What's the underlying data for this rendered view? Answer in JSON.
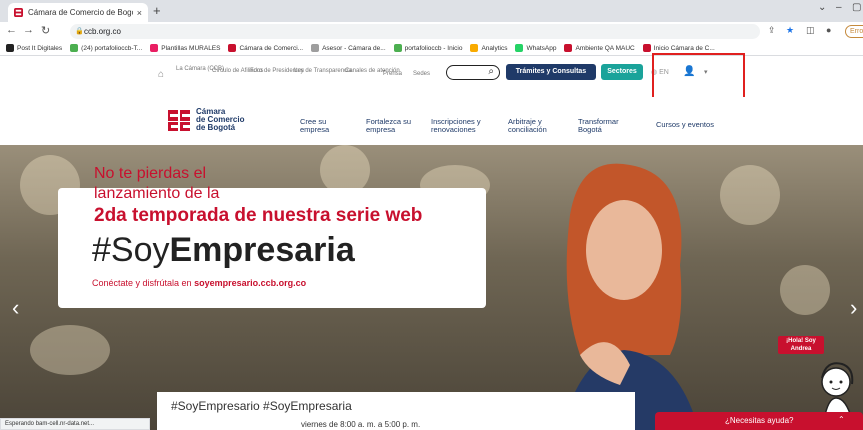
{
  "browser": {
    "tab_title": "Cámara de Comercio de Bogotá",
    "tab_close": "×",
    "new_tab": "+",
    "url": "ccb.org.co",
    "profile_label": "Erro",
    "status_text": "Esperando bam-cell.nr-data.net..."
  },
  "bookmarks": [
    {
      "label": "Post It Digitales",
      "color": "#222222"
    },
    {
      "label": "(24) portafolioccb-T...",
      "color": "#4caf50"
    },
    {
      "label": "Plantillas MURALES",
      "color": "#e91e63"
    },
    {
      "label": "Cámara de Comerci...",
      "color": "#c8102e"
    },
    {
      "label": "Asesor - Cámara de...",
      "color": "#9e9e9e"
    },
    {
      "label": "portafolioccb - Inicio",
      "color": "#4caf50"
    },
    {
      "label": "Analytics",
      "color": "#f9ab00"
    },
    {
      "label": "WhatsApp",
      "color": "#25d366"
    },
    {
      "label": "Ambiente QA MAUC",
      "color": "#c8102e"
    },
    {
      "label": "Inicio Cámara de C...",
      "color": "#c8102e"
    }
  ],
  "utility_nav": {
    "items": [
      {
        "label": "La Cámara (CCB)"
      },
      {
        "label": "Círculo de Afiliados"
      },
      {
        "label": "Foro de Presidentes"
      },
      {
        "label": "Ley de Transparencia"
      },
      {
        "label": "Canales de atención"
      },
      {
        "label": "Prensa"
      },
      {
        "label": "Sedes"
      }
    ],
    "tramites_label": "Trámites y Consultas",
    "sectores_label": "Sectores",
    "lang_label": "EN"
  },
  "main_nav": {
    "logo_text": [
      "Cámara",
      "de Comercio",
      "de Bogotá"
    ],
    "items": [
      {
        "label": "Cree su empresa"
      },
      {
        "label": "Fortalezca su empresa"
      },
      {
        "label": "Inscripciones y renovaciones"
      },
      {
        "label": "Arbitraje y conciliación"
      },
      {
        "label": "Transformar Bogotá"
      },
      {
        "label": "Cursos y eventos"
      }
    ]
  },
  "hero": {
    "top_line1": "No te pierdas el",
    "top_line2": "lanzamiento de la",
    "headline": "2da temporada de nuestra serie web",
    "hashtag_light": "#Soy",
    "hashtag_bold": "Empresaria",
    "sub_prefix": "Conéctate y disfrútala en ",
    "sub_link": "soyempresario.ccb.org.co",
    "badge": "¡Hola! Soy Andrea",
    "bottom_hashtag": "#SoyEmpresario #SoyEmpresaria",
    "bottom_hours": "viernes de 8:00 a. m. a 5:00 p. m.",
    "help": "¿Necesitas ayuda?"
  }
}
